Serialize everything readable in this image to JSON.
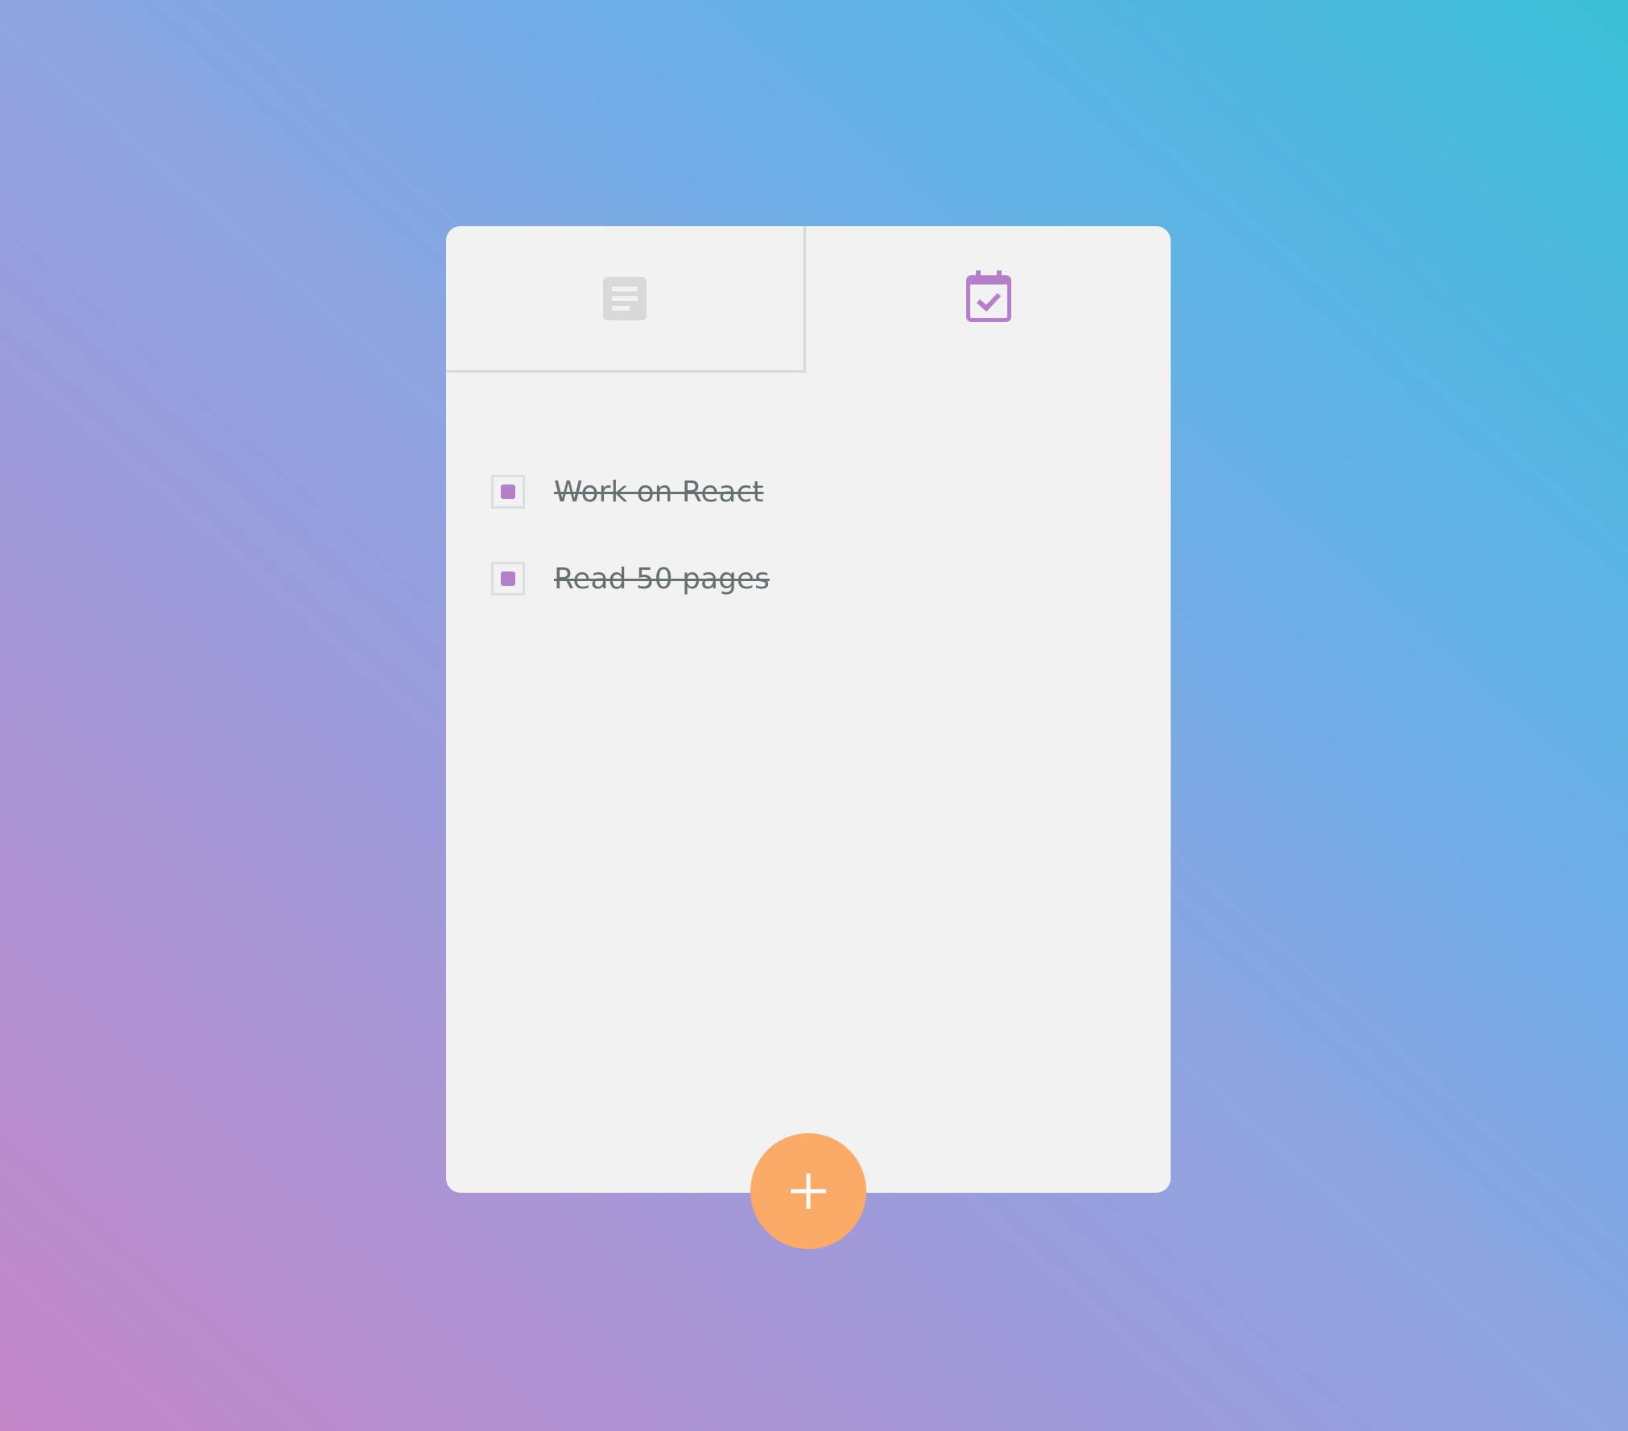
{
  "tabs": [
    {
      "icon": "notes-icon",
      "active": false
    },
    {
      "icon": "calendar-check-icon",
      "active": true
    }
  ],
  "todos": [
    {
      "text": "Work on React",
      "done": true
    },
    {
      "text": "Read 50 pages",
      "done": true
    }
  ],
  "add_button": {
    "icon": "plus-icon"
  },
  "colors": {
    "accent": "#b57fcb",
    "fab": "#fcaa68",
    "card": "#f2f2f2",
    "inactive_icon": "#d9d9d9",
    "text": "#666f72"
  }
}
